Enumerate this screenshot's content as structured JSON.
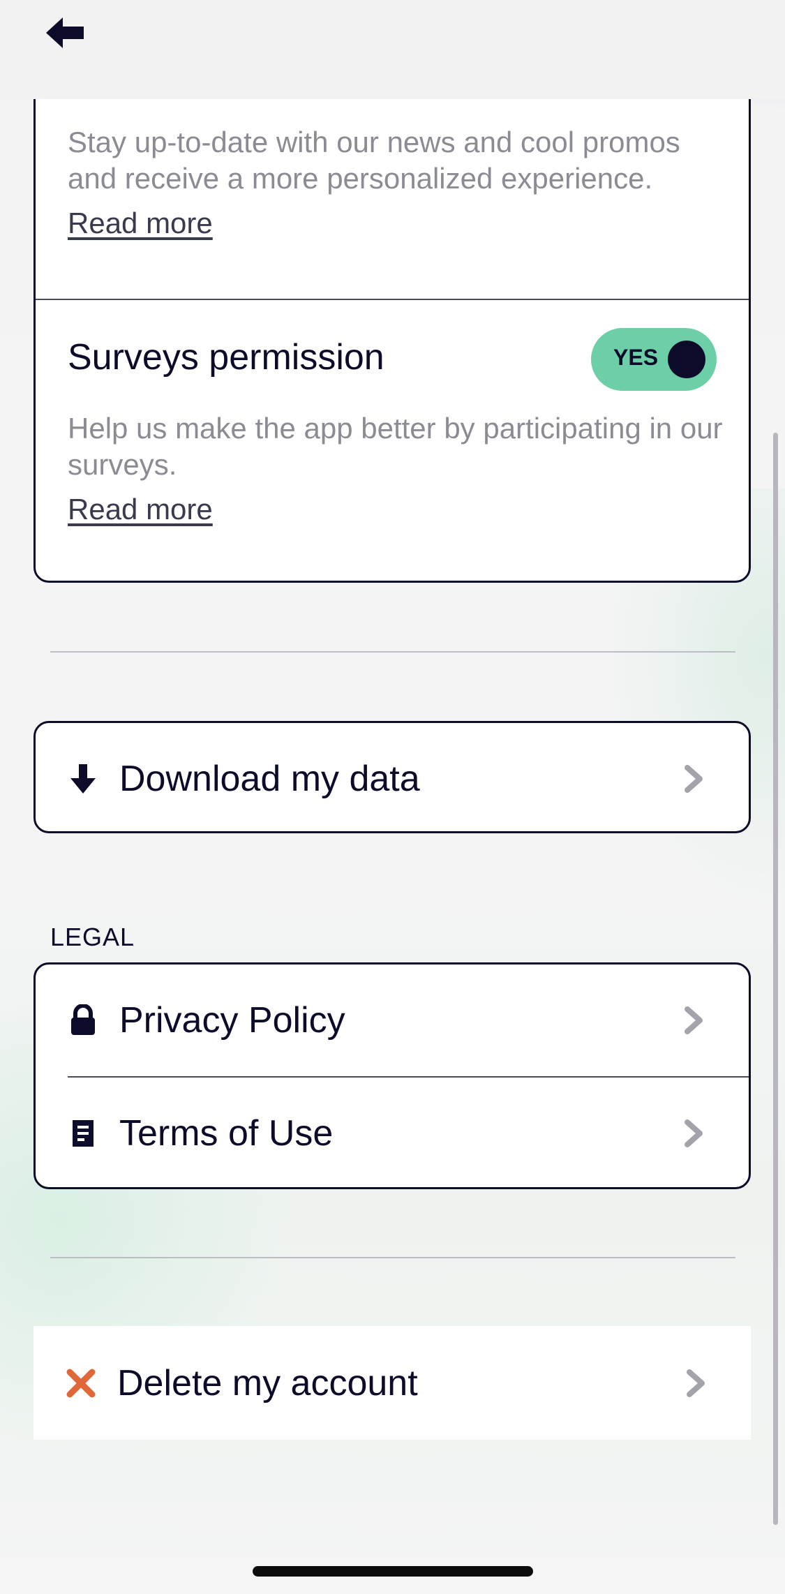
{
  "header": {
    "back_icon": "arrow-left-icon"
  },
  "consent": {
    "marketing": {
      "description": "Stay up-to-date with our news and cool promos and receive a more personalized experience.",
      "read_more": "Read more"
    },
    "surveys": {
      "title": "Surveys permission",
      "toggle_label": "YES",
      "toggle_on": true,
      "description": "Help us make the app better by participating in our surveys.",
      "read_more": "Read more"
    }
  },
  "data_section": {
    "download": {
      "label": "Download my data",
      "icon": "download-arrow-icon"
    }
  },
  "legal": {
    "heading": "LEGAL",
    "items": [
      {
        "label": "Privacy Policy",
        "icon": "lock-icon"
      },
      {
        "label": "Terms of Use",
        "icon": "document-icon"
      }
    ]
  },
  "account": {
    "delete_label": "Delete my account",
    "delete_icon": "close-x-icon"
  },
  "colors": {
    "ink": "#0c0c2a",
    "toggle_on": "#6dcfa8",
    "muted_text": "#8b8b94",
    "delete_accent": "#e0673a",
    "chevron": "#a3a3ab"
  }
}
